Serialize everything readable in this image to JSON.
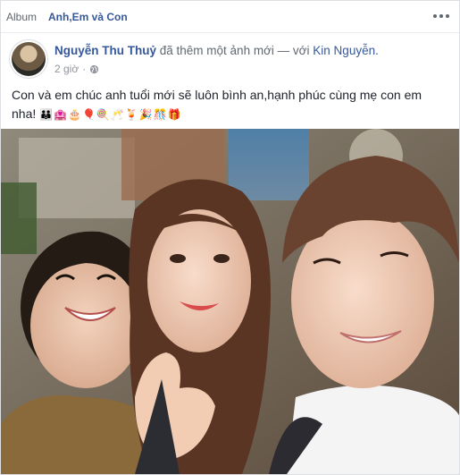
{
  "album": {
    "prefix": "Album",
    "name": "Anh,Em và Con"
  },
  "post": {
    "author": "Nguyễn Thu Thuỷ",
    "action": "đã thêm một ảnh mới — với",
    "tagged": "Kin Nguyễn.",
    "time": "2 giờ",
    "privacy_icon": "globe-icon",
    "more_icon": "more-options-icon",
    "text": "Con và em chúc anh tuổi mới sẽ luôn bình an,hạnh phúc cùng mẹ con em nha!",
    "emojis": "👪🏩🎂🎈🍭🥂🍹🎉🎊🎁"
  },
  "colors": {
    "link": "#365899",
    "text": "#1d2129",
    "meta": "#90949c"
  }
}
